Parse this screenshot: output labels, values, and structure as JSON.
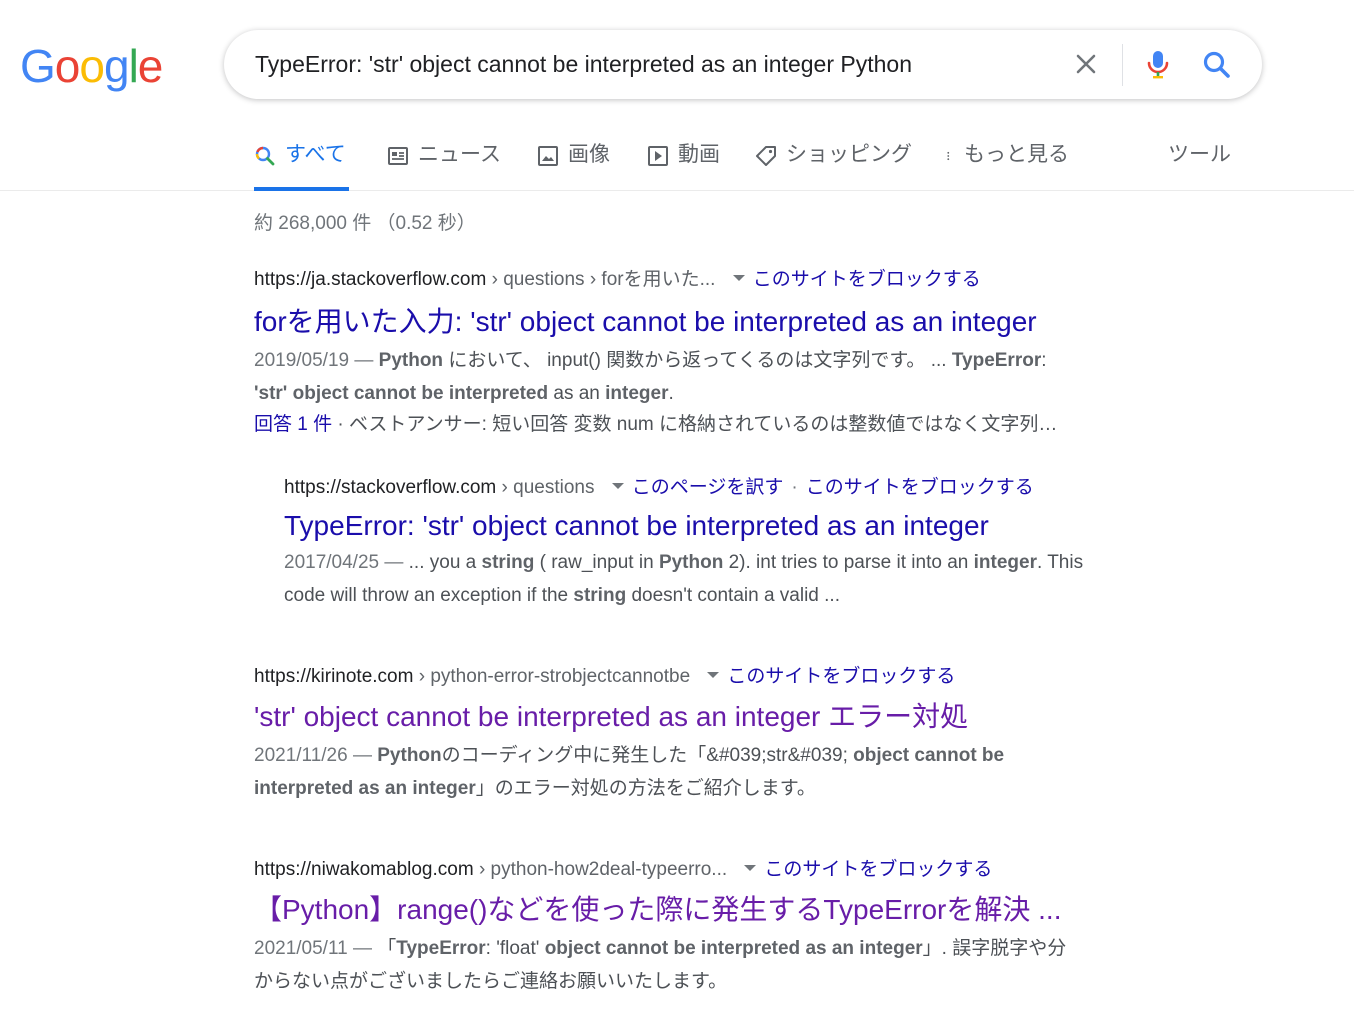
{
  "logo": {
    "letters": [
      "G",
      "o",
      "o",
      "g",
      "l",
      "e"
    ],
    "colors": [
      "#4285F4",
      "#EA4335",
      "#FBBC05",
      "#4285F4",
      "#34A853",
      "#EA4335"
    ]
  },
  "search": {
    "query": "TypeError: 'str' object cannot be interpreted as an integer Python"
  },
  "tabs": [
    {
      "label": "すべて",
      "icon": "search-icon",
      "active": true
    },
    {
      "label": "ニュース",
      "icon": "news-icon"
    },
    {
      "label": "画像",
      "icon": "image-icon"
    },
    {
      "label": "動画",
      "icon": "video-icon"
    },
    {
      "label": "ショッピング",
      "icon": "tag-icon"
    },
    {
      "label": "もっと見る",
      "icon": "more-vert-icon"
    },
    {
      "label": "ツール"
    }
  ],
  "stats": "約 268,000 件 （0.52 秒）",
  "results": [
    {
      "domain": "https://ja.stackoverflow.com",
      "path": " › questions › forを用いた...",
      "block": "このサイトをブロックする",
      "title": "forを用いた入力: 'str' object cannot be interpreted as an integer",
      "date": "2019/05/19 — ",
      "snippet_parts": [
        {
          "b": "Python"
        },
        {
          "t": " において、 input() 関数から返ってくるのは文字列です。 ... "
        },
        {
          "b": "TypeError"
        },
        {
          "t": ":"
        },
        {
          "br": true
        },
        {
          "b": "'str' object cannot be interpreted"
        },
        {
          "t": " as an "
        },
        {
          "b": "integer"
        },
        {
          "t": "."
        }
      ],
      "answers_link": "回答 1 件",
      "answers_text": " · ベストアンサー: 短い回答 変数 num に格納されているのは整数値ではなく文字列…"
    },
    {
      "domain": "https://stackoverflow.com",
      "path": " › questions",
      "translate": "このページを訳す",
      "dot": "·",
      "block": "このサイトをブロックする",
      "title": "TypeError: 'str' object cannot be interpreted as an integer",
      "date": "2017/04/25 — ",
      "snippet_parts": [
        {
          "t": "... you a "
        },
        {
          "b": "string"
        },
        {
          "t": " ( raw_input in "
        },
        {
          "b": "Python"
        },
        {
          "t": " 2). int tries to parse it into an "
        },
        {
          "b": "integer"
        },
        {
          "t": ". This"
        },
        {
          "br": true
        },
        {
          "t": "code will throw an exception if the "
        },
        {
          "b": "string"
        },
        {
          "t": " doesn't contain a valid ..."
        }
      ]
    },
    {
      "domain": "https://kirinote.com",
      "path": " › python-error-strobjectcannotbe",
      "block": "このサイトをブロックする",
      "title": "'str' object cannot be interpreted as an integer エラー対処",
      "date": "2021/11/26 — ",
      "snippet_parts": [
        {
          "b": "Python"
        },
        {
          "t": "のコーディング中に発生した「&#039;str&#039; "
        },
        {
          "b": "object cannot be"
        },
        {
          "br": true
        },
        {
          "b": "interpreted as an integer"
        },
        {
          "t": "」のエラー対処の方法をご紹介します。"
        }
      ]
    },
    {
      "domain": "https://niwakomablog.com",
      "path": " › python-how2deal-typeerro...",
      "block": "このサイトをブロックする",
      "title": "【Python】range()などを使った際に発生するTypeErrorを解決 ...",
      "date": "2021/05/11 — ",
      "snippet_parts": [
        {
          "t": "「"
        },
        {
          "b": "TypeError"
        },
        {
          "t": ": 'float' "
        },
        {
          "b": "object cannot be interpreted as an integer"
        },
        {
          "t": "」. 誤字脱字や分"
        },
        {
          "br": true
        },
        {
          "t": "からない点がございましたらご連絡お願いいたします。"
        }
      ]
    }
  ]
}
